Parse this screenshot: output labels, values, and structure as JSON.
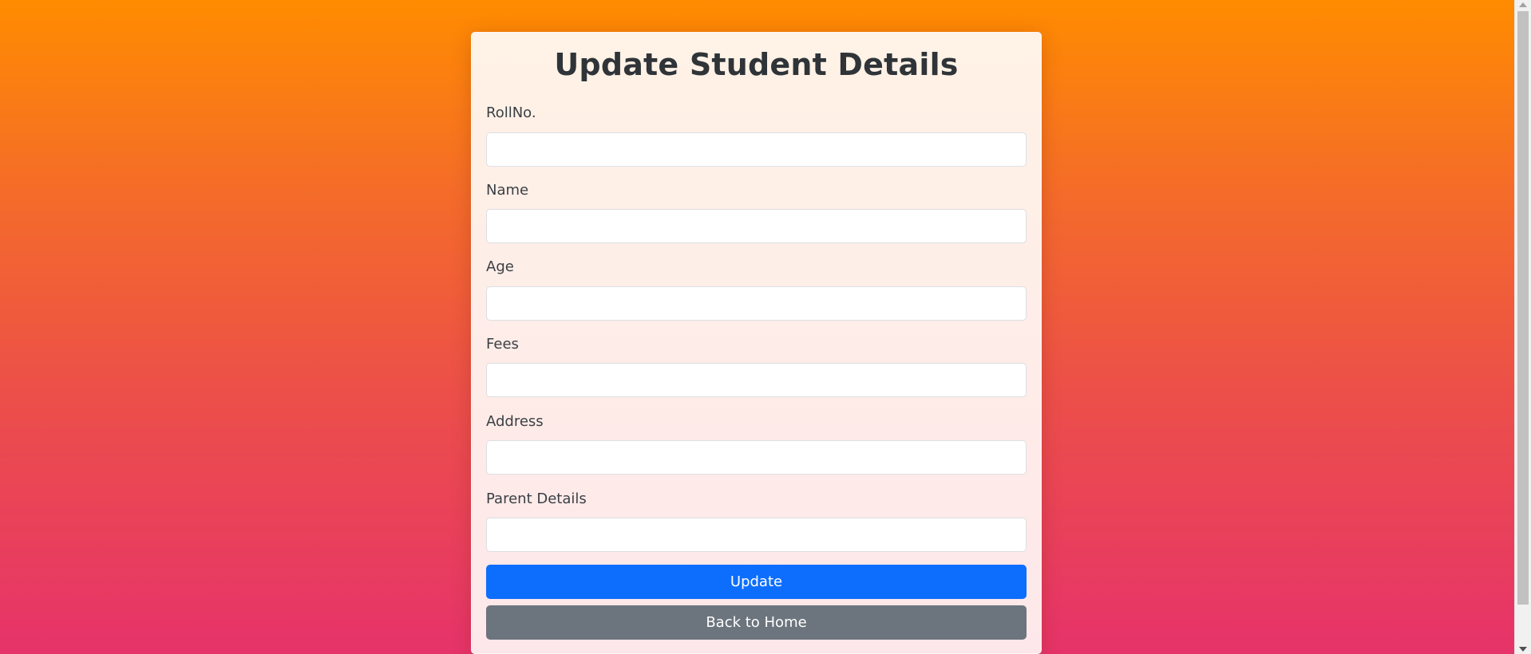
{
  "form": {
    "title": "Update Student Details",
    "fields": [
      {
        "label": "RollNo.",
        "value": "",
        "placeholder": ""
      },
      {
        "label": "Name",
        "value": "",
        "placeholder": ""
      },
      {
        "label": "Age",
        "value": "",
        "placeholder": ""
      },
      {
        "label": "Fees",
        "value": "",
        "placeholder": ""
      },
      {
        "label": "Address",
        "value": "",
        "placeholder": ""
      },
      {
        "label": "Parent Details",
        "value": "",
        "placeholder": ""
      }
    ],
    "update_label": "Update",
    "back_label": "Back to Home"
  },
  "colors": {
    "gradient_top": "#ff8c00",
    "gradient_bottom": "#e6336a",
    "primary": "#0d6efd",
    "secondary": "#6c757d"
  },
  "icons": {
    "scroll_up": "arrow-up-icon",
    "scroll_down": "arrow-down-icon"
  }
}
